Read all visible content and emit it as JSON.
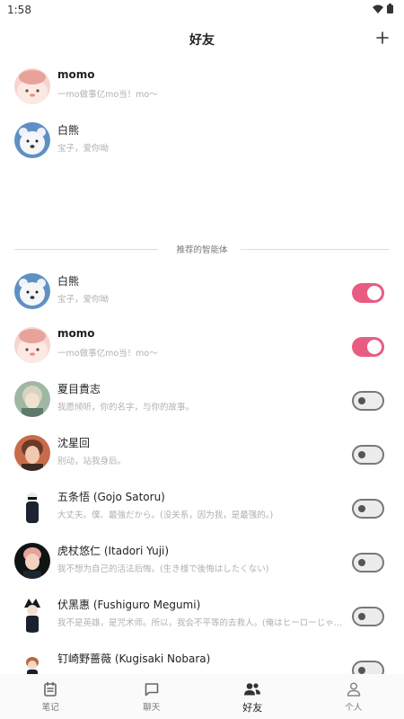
{
  "status": {
    "time": "1:58"
  },
  "header": {
    "title": "好友"
  },
  "friends": [
    {
      "name": "momo",
      "desc": "一mo做事亿mo当！mo～",
      "avatar": "momo"
    },
    {
      "name": "白熊",
      "desc": "宝子，爱你呦",
      "avatar": "bear"
    }
  ],
  "section": {
    "label": "推荐的智能体"
  },
  "agents": [
    {
      "name": "白熊",
      "desc": "宝子，爱你呦",
      "avatar": "bear",
      "enabled": true
    },
    {
      "name": "momo",
      "desc": "一mo做事亿mo当！mo～",
      "avatar": "momo",
      "enabled": true
    },
    {
      "name": "夏目貴志",
      "desc": "我愿倾听，你的名字，与你的故事。",
      "avatar": "natsume",
      "enabled": false
    },
    {
      "name": "沈星回",
      "desc": "别动，站我身后。",
      "avatar": "shen",
      "enabled": false
    },
    {
      "name": "五条悟 (Gojo Satoru)",
      "desc": "大丈夫。僕、最強だから。(没关系，因为我，是最强的。)",
      "avatar": "gojo",
      "enabled": false
    },
    {
      "name": "虎杖悠仁 (Itadori Yuji)",
      "desc": "我不想为自己的活法后悔。(生き様で後悔はしたくない)",
      "avatar": "itadori",
      "enabled": false
    },
    {
      "name": "伏黑惠 (Fushiguro Megumi)",
      "desc": "我不是英雄，是咒术师。所以，我会不平等的去救人。(俺はヒーローじゃない。呪術師なんだ)",
      "avatar": "megumi",
      "enabled": false
    },
    {
      "name": "钉崎野蔷薇 (Kugisaki Nobara)",
      "desc": "",
      "avatar": "nobara",
      "enabled": false
    }
  ],
  "nav": [
    {
      "label": "笔记",
      "icon": "notebook-icon"
    },
    {
      "label": "聊天",
      "icon": "chat-bubble-icon"
    },
    {
      "label": "好友",
      "icon": "friends-icon",
      "active": true
    },
    {
      "label": "个人",
      "icon": "person-icon"
    }
  ],
  "colors": {
    "toggle_on": "#e95c82",
    "toggle_off": "#ececec",
    "divider": "#dddddd"
  }
}
